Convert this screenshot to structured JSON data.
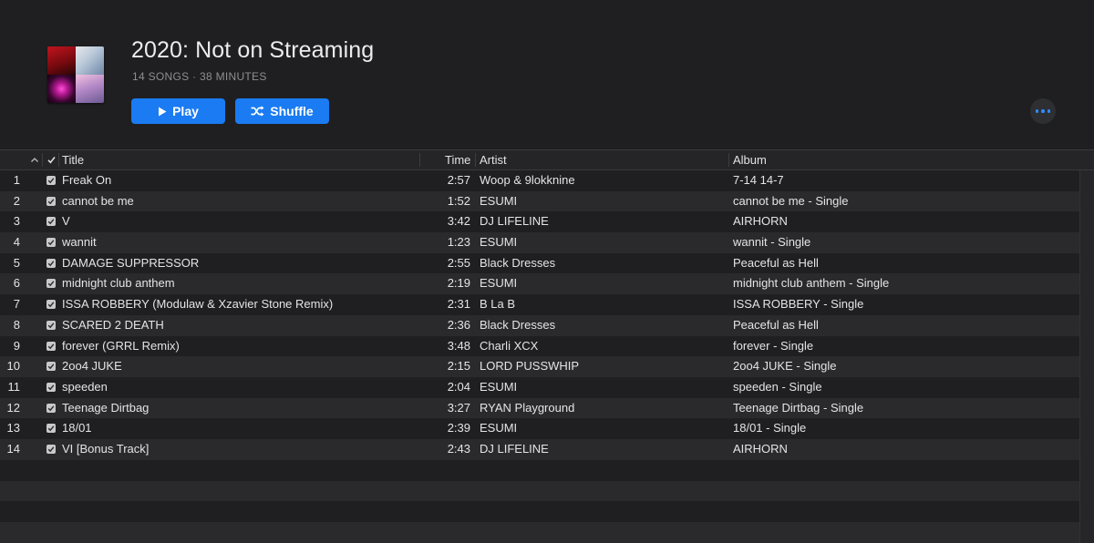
{
  "playlist": {
    "title": "2020: Not on Streaming",
    "meta": "14 SONGS · 38 MINUTES",
    "play_label": "Play",
    "shuffle_label": "Shuffle",
    "accent_color": "#1a7bf2"
  },
  "columns": {
    "title": "Title",
    "time": "Time",
    "artist": "Artist",
    "album": "Album"
  },
  "tracks": [
    {
      "num": "1",
      "title": "Freak On",
      "time": "2:57",
      "artist": "Woop & 9lokknine",
      "album": "7-14 14-7"
    },
    {
      "num": "2",
      "title": "cannot be me",
      "time": "1:52",
      "artist": "ESUMI",
      "album": "cannot be me - Single"
    },
    {
      "num": "3",
      "title": "V",
      "time": "3:42",
      "artist": "DJ LIFELINE",
      "album": "AIRHORN"
    },
    {
      "num": "4",
      "title": "wannit",
      "time": "1:23",
      "artist": "ESUMI",
      "album": "wannit - Single"
    },
    {
      "num": "5",
      "title": "DAMAGE SUPPRESSOR",
      "time": "2:55",
      "artist": "Black Dresses",
      "album": "Peaceful as Hell"
    },
    {
      "num": "6",
      "title": "midnight club anthem",
      "time": "2:19",
      "artist": "ESUMI",
      "album": "midnight club anthem - Single"
    },
    {
      "num": "7",
      "title": "ISSA ROBBERY (Modulaw & Xzavier Stone Remix)",
      "time": "2:31",
      "artist": "B La B",
      "album": "ISSA ROBBERY - Single"
    },
    {
      "num": "8",
      "title": "SCARED 2 DEATH",
      "time": "2:36",
      "artist": "Black Dresses",
      "album": "Peaceful as Hell"
    },
    {
      "num": "9",
      "title": "forever (GRRL Remix)",
      "time": "3:48",
      "artist": "Charli XCX",
      "album": "forever - Single"
    },
    {
      "num": "10",
      "title": "2oo4 JUKE",
      "time": "2:15",
      "artist": "LORD PUSSWHIP",
      "album": "2oo4 JUKE - Single"
    },
    {
      "num": "11",
      "title": "speeden",
      "time": "2:04",
      "artist": "ESUMI",
      "album": "speeden - Single"
    },
    {
      "num": "12",
      "title": "Teenage Dirtbag",
      "time": "3:27",
      "artist": "RYAN Playground",
      "album": "Teenage Dirtbag - Single"
    },
    {
      "num": "13",
      "title": "18/01",
      "time": "2:39",
      "artist": "ESUMI",
      "album": "18/01 - Single"
    },
    {
      "num": "14",
      "title": "VI [Bonus Track]",
      "time": "2:43",
      "artist": "DJ LIFELINE",
      "album": "AIRHORN"
    }
  ]
}
